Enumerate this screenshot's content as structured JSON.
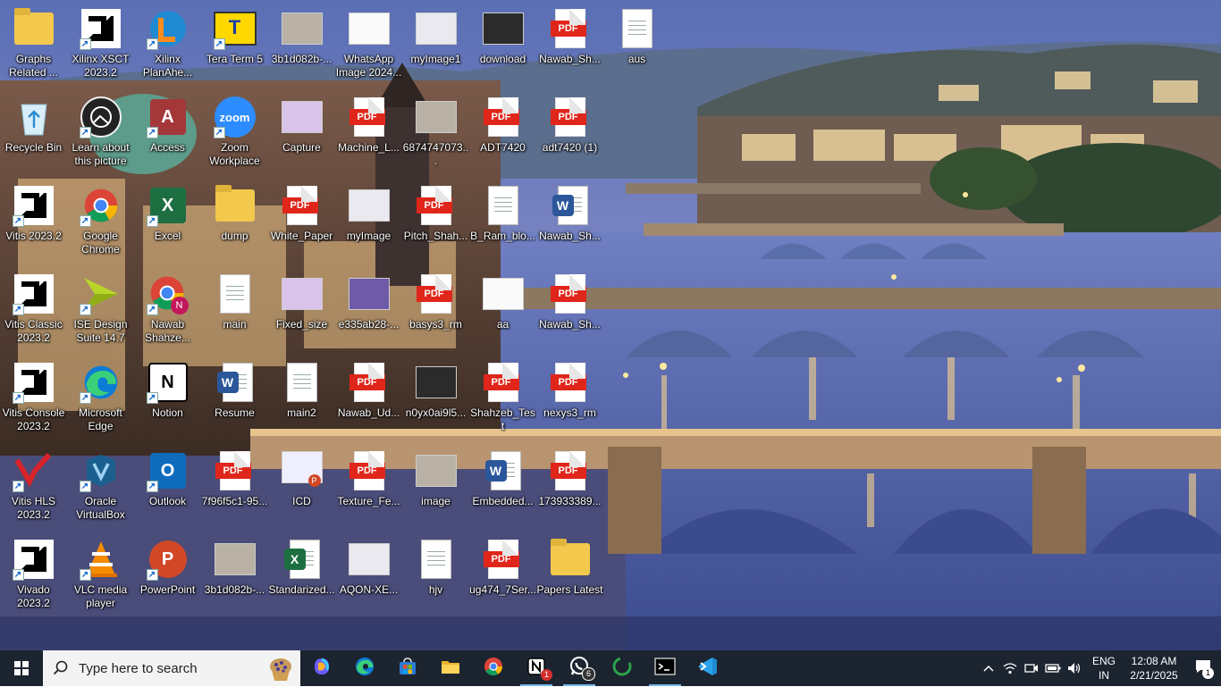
{
  "desktop": {
    "icons": [
      {
        "label": "Graphs Related ...",
        "icon": "folder-icon"
      },
      {
        "label": "Xilinx XSCT 2023.2",
        "icon": "amd-icon"
      },
      {
        "label": "Xilinx PlanAhe...",
        "icon": "planahead-icon"
      },
      {
        "label": "Tera Term 5",
        "icon": "teraterm-icon"
      },
      {
        "label": "3b1d082b-...",
        "icon": "image-icon"
      },
      {
        "label": "WhatsApp Image 2024...",
        "icon": "image-icon"
      },
      {
        "label": "myImage1",
        "icon": "image-icon"
      },
      {
        "label": "download",
        "icon": "image-icon"
      },
      {
        "label": "Nawab_Sh...",
        "icon": "pdf-icon"
      },
      {
        "label": "aus",
        "icon": "text-file-icon"
      },
      {
        "label": "Recycle Bin",
        "icon": "recycle-bin-icon"
      },
      {
        "label": "Learn about this picture",
        "icon": "learn-picture-icon"
      },
      {
        "label": "Access",
        "icon": "access-icon"
      },
      {
        "label": "Zoom Workplace",
        "icon": "zoom-icon"
      },
      {
        "label": "Capture",
        "icon": "image-icon"
      },
      {
        "label": "Machine_L...",
        "icon": "pdf-icon"
      },
      {
        "label": "6874747073...",
        "icon": "image-icon"
      },
      {
        "label": "ADT7420",
        "icon": "pdf-icon"
      },
      {
        "label": "adt7420 (1)",
        "icon": "pdf-icon"
      },
      {
        "label": "Vitis 2023.2",
        "icon": "amd-icon"
      },
      {
        "label": "Google Chrome",
        "icon": "chrome-icon"
      },
      {
        "label": "Excel",
        "icon": "excel-icon"
      },
      {
        "label": "dump",
        "icon": "folder-icon"
      },
      {
        "label": "White_Paper",
        "icon": "pdf-icon"
      },
      {
        "label": "myImage",
        "icon": "image-icon"
      },
      {
        "label": "Pitch_Shah...",
        "icon": "pdf-icon"
      },
      {
        "label": "B_Ram_blo...",
        "icon": "text-file-icon"
      },
      {
        "label": "Nawab_Sh...",
        "icon": "word-icon"
      },
      {
        "label": "Vitis Classic 2023.2",
        "icon": "amd-icon"
      },
      {
        "label": "ISE Design Suite 14.7",
        "icon": "ise-icon"
      },
      {
        "label": "Nawab Shahze...",
        "icon": "chrome-profile-icon"
      },
      {
        "label": "main",
        "icon": "text-file-icon"
      },
      {
        "label": "Fixed_size",
        "icon": "image-icon"
      },
      {
        "label": "e335ab28-...",
        "icon": "image-icon"
      },
      {
        "label": "basys3_rm",
        "icon": "pdf-icon"
      },
      {
        "label": "aa",
        "icon": "image-icon"
      },
      {
        "label": "Nawab_Sh...",
        "icon": "pdf-icon"
      },
      {
        "label": "Vitis Console 2023.2",
        "icon": "amd-icon"
      },
      {
        "label": "Microsoft Edge",
        "icon": "edge-icon"
      },
      {
        "label": "Notion",
        "icon": "notion-icon"
      },
      {
        "label": "Resume",
        "icon": "word-icon"
      },
      {
        "label": "main2",
        "icon": "text-file-icon"
      },
      {
        "label": "Nawab_Ud...",
        "icon": "pdf-icon"
      },
      {
        "label": "n0yx0ai9l5...",
        "icon": "image-icon"
      },
      {
        "label": "Shahzeb_Test",
        "icon": "pdf-icon"
      },
      {
        "label": "nexys3_rm",
        "icon": "pdf-icon"
      },
      {
        "label": "Vitis HLS 2023.2",
        "icon": "vitis-hls-icon"
      },
      {
        "label": "Oracle VirtualBox",
        "icon": "virtualbox-icon"
      },
      {
        "label": "Outlook",
        "icon": "outlook-icon"
      },
      {
        "label": "7f96f5c1-95...",
        "icon": "pdf-icon"
      },
      {
        "label": "ICD",
        "icon": "powerpoint-file-icon"
      },
      {
        "label": "Texture_Fe...",
        "icon": "pdf-icon"
      },
      {
        "label": "image",
        "icon": "image-icon"
      },
      {
        "label": "Embedded...",
        "icon": "word-icon"
      },
      {
        "label": "173933389...",
        "icon": "pdf-icon"
      },
      {
        "label": "Vivado 2023.2",
        "icon": "amd-icon"
      },
      {
        "label": "VLC media player",
        "icon": "vlc-icon"
      },
      {
        "label": "PowerPoint",
        "icon": "powerpoint-icon"
      },
      {
        "label": "3b1d082b-...",
        "icon": "image-icon"
      },
      {
        "label": "Standarized...",
        "icon": "excel-file-icon"
      },
      {
        "label": "AQON-XE...",
        "icon": "image-icon"
      },
      {
        "label": "hjv",
        "icon": "text-file-icon"
      },
      {
        "label": "ug474_7Ser...",
        "icon": "pdf-icon"
      },
      {
        "label": "Papers Latest",
        "icon": "folder-icon"
      }
    ],
    "pdf_tag": "PDF"
  },
  "taskbar": {
    "search_placeholder": "Type here to search",
    "apps": [
      {
        "name": "copilot",
        "icon": "copilot-icon"
      },
      {
        "name": "edge",
        "icon": "edge-icon"
      },
      {
        "name": "store",
        "icon": "store-icon"
      },
      {
        "name": "file-explorer",
        "icon": "folder-icon"
      },
      {
        "name": "chrome",
        "icon": "chrome-icon"
      },
      {
        "name": "notion",
        "icon": "notion-icon",
        "badge": "1"
      },
      {
        "name": "whatsapp",
        "icon": "whatsapp-icon",
        "badge": "6"
      },
      {
        "name": "loader",
        "icon": "spinner-icon"
      },
      {
        "name": "terminal",
        "icon": "terminal-icon"
      },
      {
        "name": "vscode",
        "icon": "vscode-icon"
      }
    ],
    "tray": {
      "lang_top": "ENG",
      "lang_bottom": "IN",
      "time": "12:08 AM",
      "date": "2/21/2025",
      "notification_count": "1"
    }
  },
  "colors": {
    "taskbar_bg": "#1c2430",
    "pdf_red": "#e0261b",
    "accent": "#76b9ed"
  }
}
